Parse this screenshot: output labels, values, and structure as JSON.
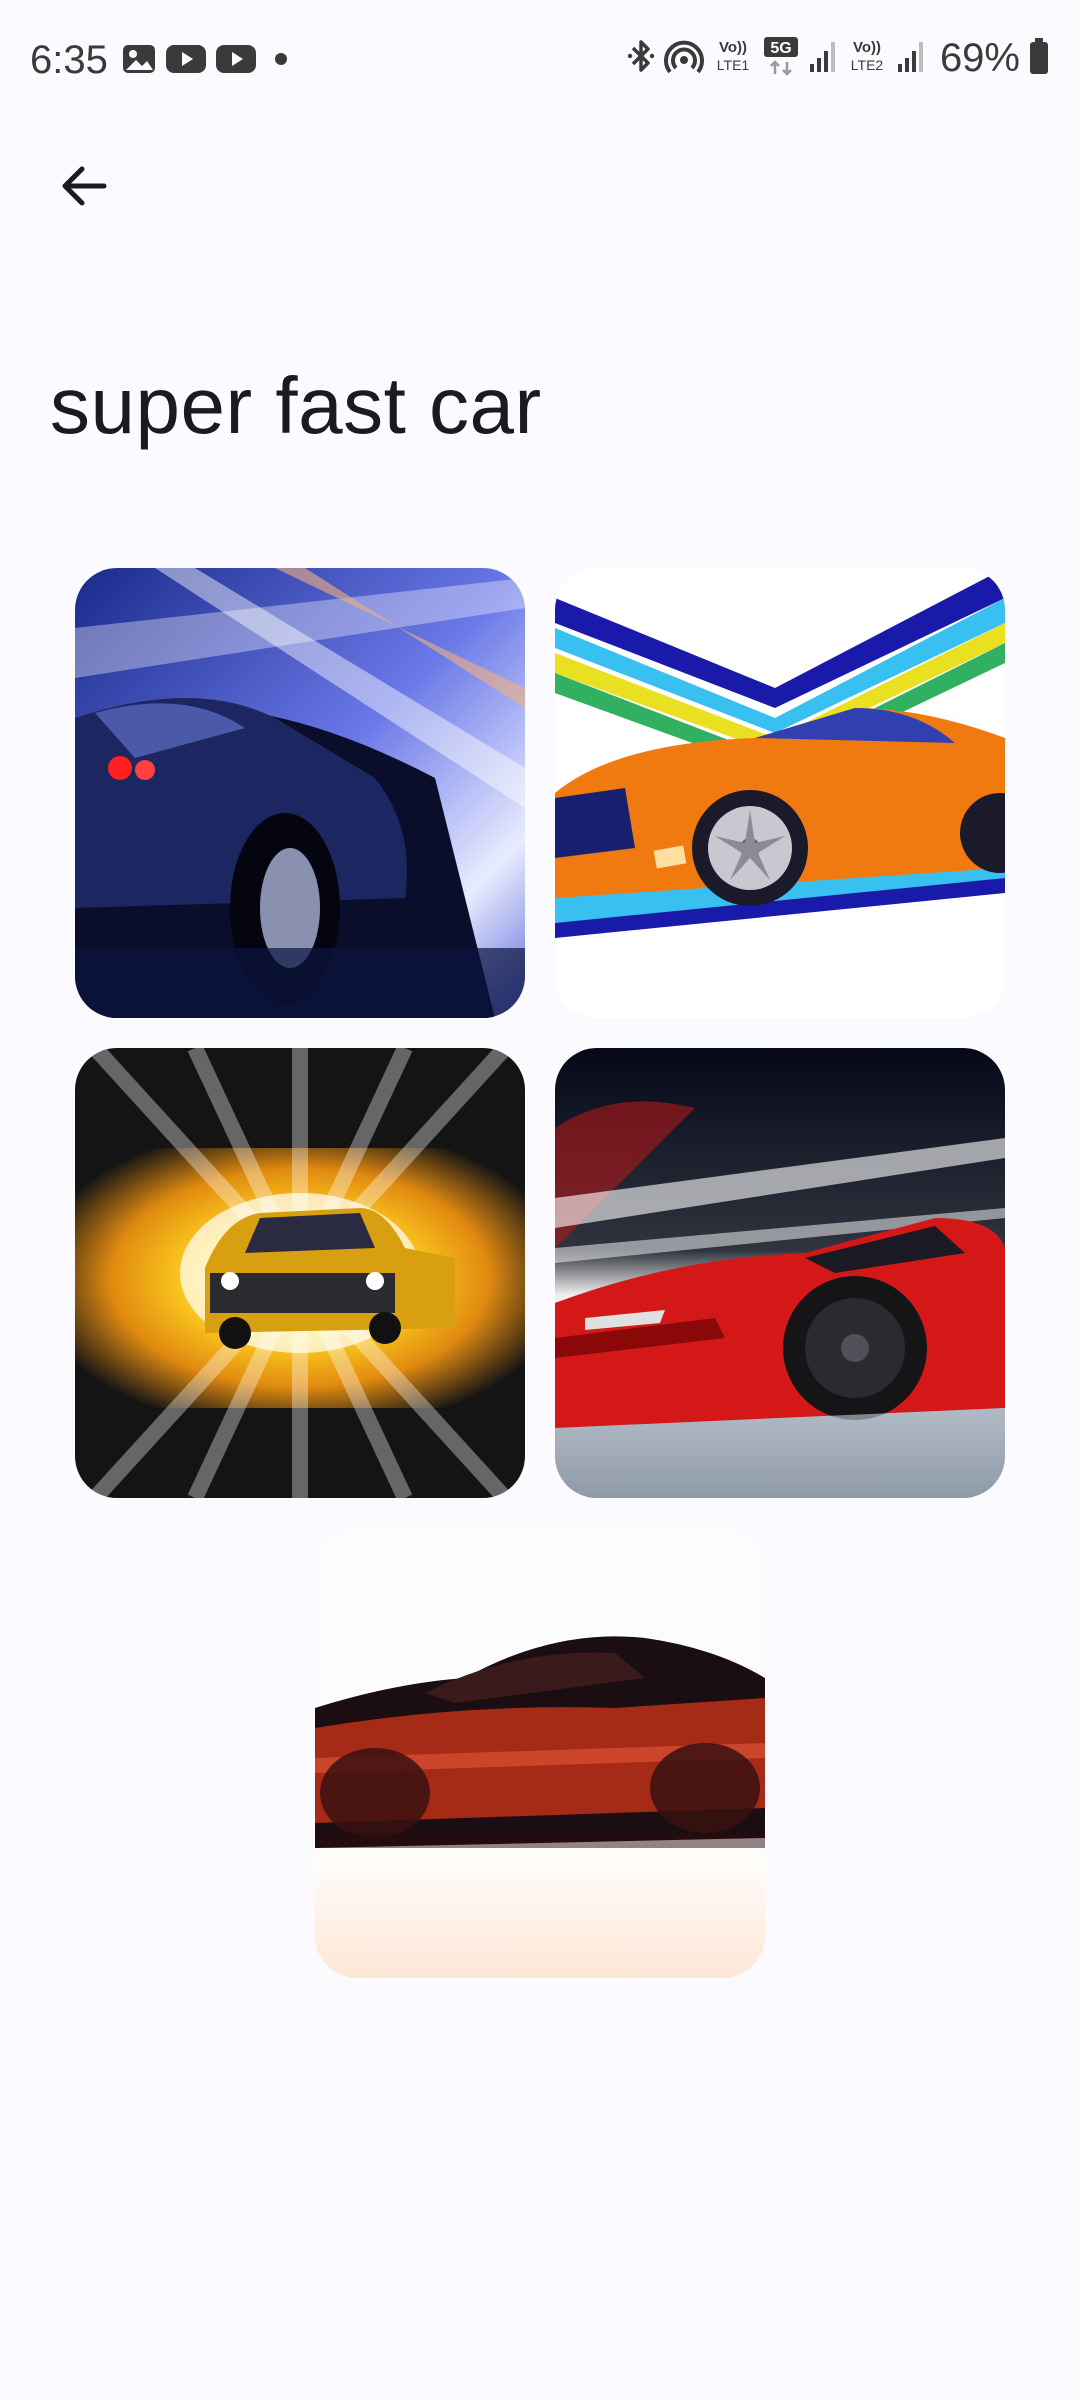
{
  "status_bar": {
    "time": "6:35",
    "left_icons": [
      "gallery-icon",
      "youtube-icon",
      "youtube-icon",
      "notification-dot-icon"
    ],
    "right_icons": [
      "bluetooth-icon",
      "hotspot-icon",
      "volte-lte1-icon",
      "5g-icon",
      "signal-icon",
      "volte-lte2-icon",
      "signal-icon",
      "battery-icon"
    ],
    "volte1_label": "Vo)) LTE1",
    "network_label": "5G",
    "volte2_label": "Vo)) LTE2",
    "battery_percent": "69%"
  },
  "header": {
    "back_icon": "arrow-left-icon"
  },
  "prompt": {
    "title": "super fast car"
  },
  "results": [
    {
      "name": "generated-image-1",
      "description_icon": "blue-sports-car-image"
    },
    {
      "name": "generated-image-2",
      "description_icon": "orange-cartoon-car-image"
    },
    {
      "name": "generated-image-3",
      "description_icon": "yellow-muscle-car-image"
    },
    {
      "name": "generated-image-4",
      "description_icon": "red-supercar-image"
    },
    {
      "name": "generated-image-5",
      "description_icon": "red-black-sports-car-image"
    }
  ],
  "colors": {
    "background": "#fbfaff",
    "text": "#1b1b1f"
  }
}
